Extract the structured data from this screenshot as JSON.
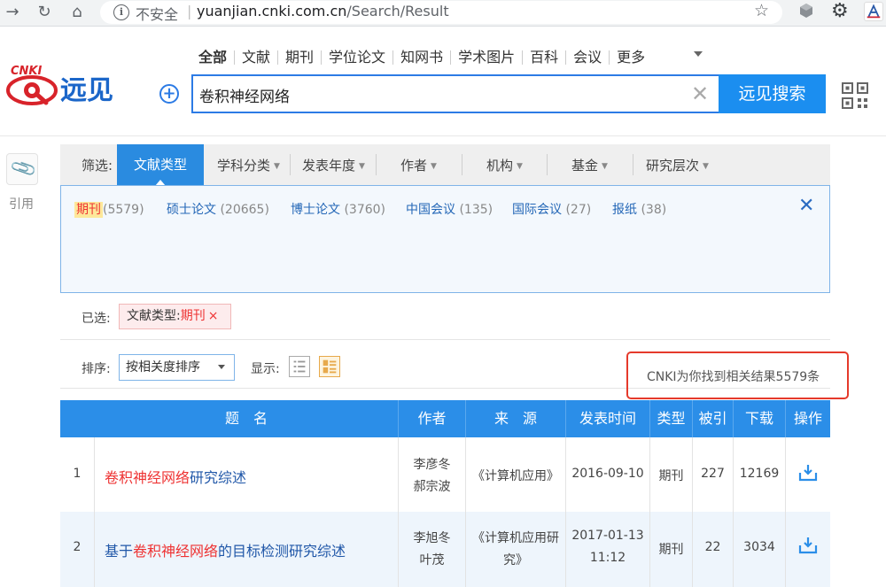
{
  "browser": {
    "insecure_label": "不安全",
    "url_host": "yuanjian.cnki.com.cn",
    "url_path": "/Search/Result"
  },
  "header": {
    "categories": [
      "全部",
      "文献",
      "期刊",
      "学位论文",
      "知网书",
      "学术图片",
      "百科",
      "会议",
      "更多"
    ],
    "search_value": "卷积神经网络",
    "search_button": "远见搜索"
  },
  "sidebar": {
    "cite_label": "引用"
  },
  "filter": {
    "label": "筛选:",
    "tabs": [
      "文献类型",
      "学科分类",
      "发表年度",
      "作者",
      "机构",
      "基金",
      "研究层次"
    ],
    "types": [
      {
        "name": "期刊",
        "count": "(5579)"
      },
      {
        "name": "硕士论文",
        "count": "(20665)"
      },
      {
        "name": "博士论文",
        "count": "(3760)"
      },
      {
        "name": "中国会议",
        "count": "(135)"
      },
      {
        "name": "国际会议",
        "count": "(27)"
      },
      {
        "name": "报纸",
        "count": "(38)"
      }
    ]
  },
  "selected": {
    "label": "已选:",
    "chip_key": "文献类型:",
    "chip_value": "期刊",
    "chip_close": "×"
  },
  "sort": {
    "label": "排序:",
    "value": "按相关度排序",
    "display_label": "显示:"
  },
  "result_summary": "CNKI为你找到相关结果5579条",
  "table": {
    "headers": [
      "题　名",
      "作者",
      "来　源",
      "发表时间",
      "类型",
      "被引",
      "下载",
      "操作"
    ],
    "rows": [
      {
        "index": "1",
        "title_highlight": "卷积神经网络",
        "title_prefix": "",
        "title_suffix": "研究综述",
        "author_1": "李彦冬",
        "author_2": "郝宗波",
        "source_1": "《计算机应用》",
        "source_2": "",
        "date_1": "2016-09-10",
        "date_2": "",
        "type": "期刊",
        "cited": "227",
        "downloads": "12169"
      },
      {
        "index": "2",
        "title_prefix": "基于",
        "title_highlight": "卷积神经网络",
        "title_suffix": "的目标检测研究综述",
        "author_1": "李旭冬",
        "author_2": "叶茂",
        "source_1": "《计算机应用研",
        "source_2": "究》",
        "date_1": "2017-01-13",
        "date_2": "11:12",
        "type": "期刊",
        "cited": "22",
        "downloads": "3034"
      }
    ]
  },
  "colors": {
    "primary": "#2b8ee8",
    "highlight": "#e33333",
    "link": "#2057a8"
  }
}
